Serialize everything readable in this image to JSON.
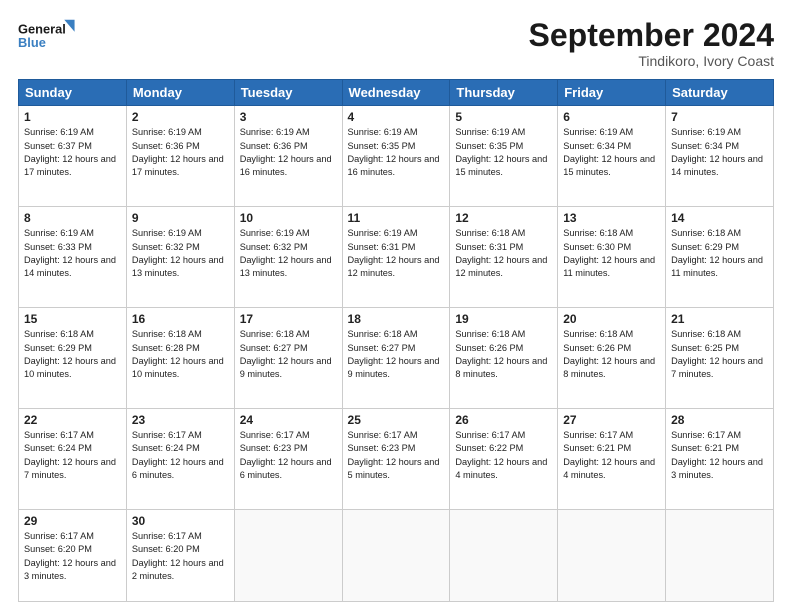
{
  "header": {
    "logo_line1": "General",
    "logo_line2": "Blue",
    "month": "September 2024",
    "location": "Tindikoro, Ivory Coast"
  },
  "weekdays": [
    "Sunday",
    "Monday",
    "Tuesday",
    "Wednesday",
    "Thursday",
    "Friday",
    "Saturday"
  ],
  "weeks": [
    [
      {
        "day": "1",
        "sunrise": "Sunrise: 6:19 AM",
        "sunset": "Sunset: 6:37 PM",
        "daylight": "Daylight: 12 hours and 17 minutes."
      },
      {
        "day": "2",
        "sunrise": "Sunrise: 6:19 AM",
        "sunset": "Sunset: 6:36 PM",
        "daylight": "Daylight: 12 hours and 17 minutes."
      },
      {
        "day": "3",
        "sunrise": "Sunrise: 6:19 AM",
        "sunset": "Sunset: 6:36 PM",
        "daylight": "Daylight: 12 hours and 16 minutes."
      },
      {
        "day": "4",
        "sunrise": "Sunrise: 6:19 AM",
        "sunset": "Sunset: 6:35 PM",
        "daylight": "Daylight: 12 hours and 16 minutes."
      },
      {
        "day": "5",
        "sunrise": "Sunrise: 6:19 AM",
        "sunset": "Sunset: 6:35 PM",
        "daylight": "Daylight: 12 hours and 15 minutes."
      },
      {
        "day": "6",
        "sunrise": "Sunrise: 6:19 AM",
        "sunset": "Sunset: 6:34 PM",
        "daylight": "Daylight: 12 hours and 15 minutes."
      },
      {
        "day": "7",
        "sunrise": "Sunrise: 6:19 AM",
        "sunset": "Sunset: 6:34 PM",
        "daylight": "Daylight: 12 hours and 14 minutes."
      }
    ],
    [
      {
        "day": "8",
        "sunrise": "Sunrise: 6:19 AM",
        "sunset": "Sunset: 6:33 PM",
        "daylight": "Daylight: 12 hours and 14 minutes."
      },
      {
        "day": "9",
        "sunrise": "Sunrise: 6:19 AM",
        "sunset": "Sunset: 6:32 PM",
        "daylight": "Daylight: 12 hours and 13 minutes."
      },
      {
        "day": "10",
        "sunrise": "Sunrise: 6:19 AM",
        "sunset": "Sunset: 6:32 PM",
        "daylight": "Daylight: 12 hours and 13 minutes."
      },
      {
        "day": "11",
        "sunrise": "Sunrise: 6:19 AM",
        "sunset": "Sunset: 6:31 PM",
        "daylight": "Daylight: 12 hours and 12 minutes."
      },
      {
        "day": "12",
        "sunrise": "Sunrise: 6:18 AM",
        "sunset": "Sunset: 6:31 PM",
        "daylight": "Daylight: 12 hours and 12 minutes."
      },
      {
        "day": "13",
        "sunrise": "Sunrise: 6:18 AM",
        "sunset": "Sunset: 6:30 PM",
        "daylight": "Daylight: 12 hours and 11 minutes."
      },
      {
        "day": "14",
        "sunrise": "Sunrise: 6:18 AM",
        "sunset": "Sunset: 6:29 PM",
        "daylight": "Daylight: 12 hours and 11 minutes."
      }
    ],
    [
      {
        "day": "15",
        "sunrise": "Sunrise: 6:18 AM",
        "sunset": "Sunset: 6:29 PM",
        "daylight": "Daylight: 12 hours and 10 minutes."
      },
      {
        "day": "16",
        "sunrise": "Sunrise: 6:18 AM",
        "sunset": "Sunset: 6:28 PM",
        "daylight": "Daylight: 12 hours and 10 minutes."
      },
      {
        "day": "17",
        "sunrise": "Sunrise: 6:18 AM",
        "sunset": "Sunset: 6:27 PM",
        "daylight": "Daylight: 12 hours and 9 minutes."
      },
      {
        "day": "18",
        "sunrise": "Sunrise: 6:18 AM",
        "sunset": "Sunset: 6:27 PM",
        "daylight": "Daylight: 12 hours and 9 minutes."
      },
      {
        "day": "19",
        "sunrise": "Sunrise: 6:18 AM",
        "sunset": "Sunset: 6:26 PM",
        "daylight": "Daylight: 12 hours and 8 minutes."
      },
      {
        "day": "20",
        "sunrise": "Sunrise: 6:18 AM",
        "sunset": "Sunset: 6:26 PM",
        "daylight": "Daylight: 12 hours and 8 minutes."
      },
      {
        "day": "21",
        "sunrise": "Sunrise: 6:18 AM",
        "sunset": "Sunset: 6:25 PM",
        "daylight": "Daylight: 12 hours and 7 minutes."
      }
    ],
    [
      {
        "day": "22",
        "sunrise": "Sunrise: 6:17 AM",
        "sunset": "Sunset: 6:24 PM",
        "daylight": "Daylight: 12 hours and 7 minutes."
      },
      {
        "day": "23",
        "sunrise": "Sunrise: 6:17 AM",
        "sunset": "Sunset: 6:24 PM",
        "daylight": "Daylight: 12 hours and 6 minutes."
      },
      {
        "day": "24",
        "sunrise": "Sunrise: 6:17 AM",
        "sunset": "Sunset: 6:23 PM",
        "daylight": "Daylight: 12 hours and 6 minutes."
      },
      {
        "day": "25",
        "sunrise": "Sunrise: 6:17 AM",
        "sunset": "Sunset: 6:23 PM",
        "daylight": "Daylight: 12 hours and 5 minutes."
      },
      {
        "day": "26",
        "sunrise": "Sunrise: 6:17 AM",
        "sunset": "Sunset: 6:22 PM",
        "daylight": "Daylight: 12 hours and 4 minutes."
      },
      {
        "day": "27",
        "sunrise": "Sunrise: 6:17 AM",
        "sunset": "Sunset: 6:21 PM",
        "daylight": "Daylight: 12 hours and 4 minutes."
      },
      {
        "day": "28",
        "sunrise": "Sunrise: 6:17 AM",
        "sunset": "Sunset: 6:21 PM",
        "daylight": "Daylight: 12 hours and 3 minutes."
      }
    ],
    [
      {
        "day": "29",
        "sunrise": "Sunrise: 6:17 AM",
        "sunset": "Sunset: 6:20 PM",
        "daylight": "Daylight: 12 hours and 3 minutes."
      },
      {
        "day": "30",
        "sunrise": "Sunrise: 6:17 AM",
        "sunset": "Sunset: 6:20 PM",
        "daylight": "Daylight: 12 hours and 2 minutes."
      },
      null,
      null,
      null,
      null,
      null
    ]
  ]
}
